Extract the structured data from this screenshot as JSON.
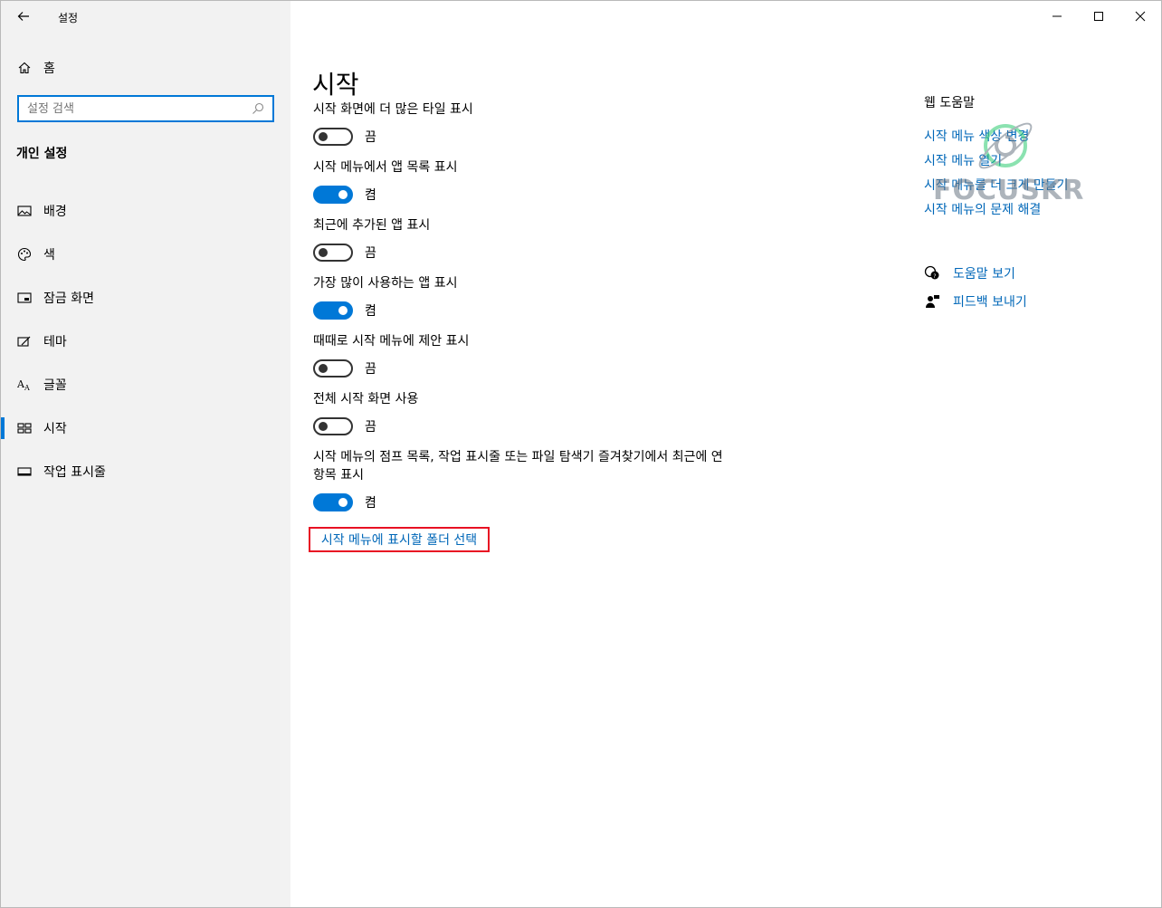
{
  "window": {
    "app_title": "설정"
  },
  "sidebar": {
    "home_label": "홈",
    "search_placeholder": "설정 검색",
    "section_title": "개인 설정",
    "items": [
      {
        "label": "배경",
        "icon": "picture-icon"
      },
      {
        "label": "색",
        "icon": "palette-icon"
      },
      {
        "label": "잠금 화면",
        "icon": "lock-screen-icon"
      },
      {
        "label": "테마",
        "icon": "theme-brush-icon"
      },
      {
        "label": "글꼴",
        "icon": "font-icon"
      },
      {
        "label": "시작",
        "icon": "start-grid-icon",
        "active": true
      },
      {
        "label": "작업 표시줄",
        "icon": "taskbar-icon"
      }
    ]
  },
  "main": {
    "page_title": "시작",
    "settings": [
      {
        "label": "시작 화면에 더 많은 타일 표시",
        "state": "끔",
        "on": false
      },
      {
        "label": "시작 메뉴에서 앱 목록 표시",
        "state": "켬",
        "on": true
      },
      {
        "label": "최근에 추가된 앱 표시",
        "state": "끔",
        "on": false
      },
      {
        "label": "가장 많이 사용하는 앱 표시",
        "state": "켬",
        "on": true
      },
      {
        "label": "때때로 시작 메뉴에 제안 표시",
        "state": "끔",
        "on": false
      },
      {
        "label": "전체 시작 화면 사용",
        "state": "끔",
        "on": false
      },
      {
        "label": "시작 메뉴의 점프 목록, 작업 표시줄 또는 파일 탐색기 즐겨찾기에서 최근에 연 항목 표시",
        "state": "켬",
        "on": true
      }
    ],
    "folder_link": "시작 메뉴에 표시할 폴더 선택"
  },
  "help": {
    "title": "웹 도움말",
    "links": [
      "시작 메뉴 색상 변경",
      "시작 메뉴 열기",
      "시작 메뉴를 더 크게 만들기",
      "시작 메뉴의 문제 해결"
    ],
    "get_help": "도움말 보기",
    "feedback": "피드백 보내기"
  },
  "watermark": {
    "text": "FOCUSKR"
  },
  "colors": {
    "accent": "#0078d7",
    "link": "#0067b8",
    "highlight_border": "#e81123"
  }
}
